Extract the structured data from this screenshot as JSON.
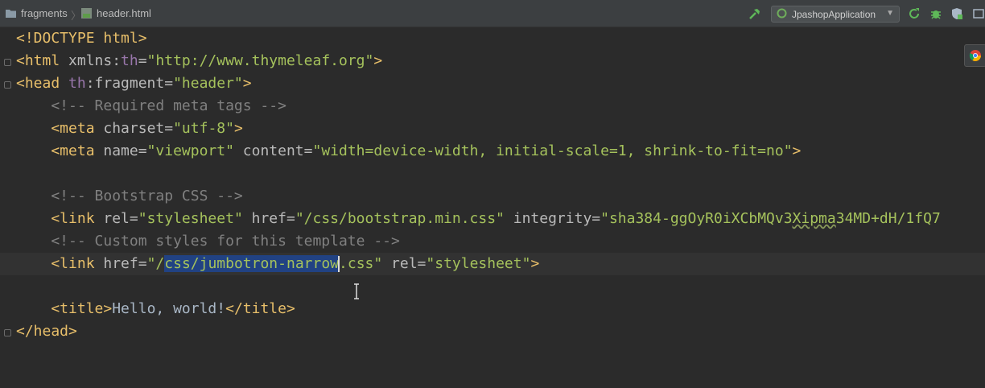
{
  "breadcrumb": [
    {
      "label": "fragments",
      "icon": "folder-icon"
    },
    {
      "label": "header.html",
      "icon": "html-file-icon"
    }
  ],
  "toolbar": {
    "run_config": "JpashopApplication",
    "icons": [
      "build-hammer-icon",
      "rerun-icon",
      "debug-bug-icon",
      "stop-shield-icon"
    ]
  },
  "code": {
    "l1": {
      "a": "<!DOCTYPE html>"
    },
    "l2": {
      "open": "<html",
      "attr": " xmlns:",
      "ns": "th",
      "eq": "=",
      "val": "\"http://www.thymeleaf.org\"",
      "close": ">"
    },
    "l3": {
      "open": "<head",
      "ns": " th",
      "attr": ":fragment=",
      "val": "\"header\"",
      "close": ">"
    },
    "l4": {
      "cmt": "    <!-- Required meta tags -->"
    },
    "l5": {
      "open": "    <meta",
      "attr": " charset=",
      "val": "\"utf-8\"",
      "close": ">"
    },
    "l6": {
      "open": "    <meta",
      "attr1": " name=",
      "val1": "\"viewport\"",
      "attr2": " content=",
      "val2": "\"width=device-width, initial-scale=1, shrink-to-fit=no\"",
      "close": ">"
    },
    "l8": {
      "cmt": "    <!-- Bootstrap CSS -->"
    },
    "l9": {
      "open": "    <link",
      "attr1": " rel=",
      "val1": "\"stylesheet\"",
      "attr2": " href=",
      "val2": "\"/css/bootstrap.min.css\"",
      "attr3": " integrity=",
      "val3a": "\"sha384-ggOyR0iXCbMQv3",
      "val3b": "Xipma",
      "val3c": "34MD+dH/1fQ7"
    },
    "l10": {
      "cmt": "    <!-- Custom styles for this template -->"
    },
    "l11": {
      "open": "    <link",
      "attr1": " href=",
      "val1a": "\"/",
      "sel": "css/jumbotron-narrow",
      "val1b": ".css\"",
      "attr2": " rel=",
      "val2": "\"stylesheet\"",
      "close": ">"
    },
    "l13": {
      "open": "    <title>",
      "text": "Hello, world!",
      "close": "</title>"
    },
    "l14": {
      "a": "</head>"
    }
  }
}
